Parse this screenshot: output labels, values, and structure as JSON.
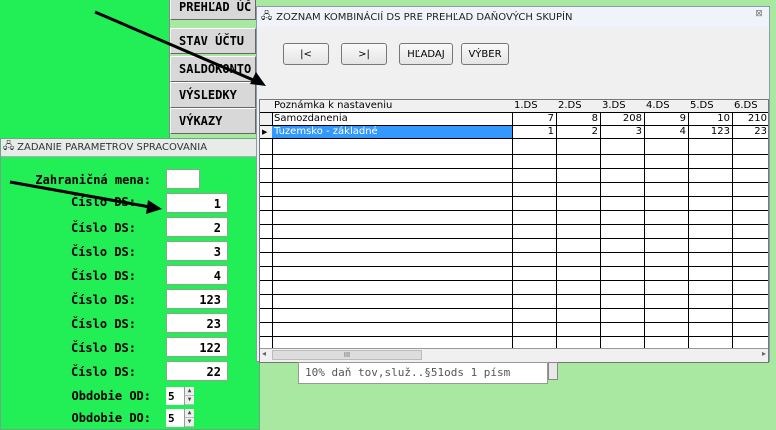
{
  "menu": [
    {
      "label": "PREHĽAD ÚČ"
    },
    {
      "label": "STAV ÚČTU"
    },
    {
      "label": "SALDOKONTO"
    },
    {
      "label": "VÝSLEDKY"
    },
    {
      "label": "VÝKAZY"
    }
  ],
  "param_window": {
    "title": "ZADANIE PARAMETROV SPRACOVANIA",
    "rows": [
      {
        "label": "Zahraničná mena:",
        "value": ""
      },
      {
        "label": "Číslo DS:",
        "value": "1"
      },
      {
        "label": "Číslo DS:",
        "value": "2"
      },
      {
        "label": "Číslo DS:",
        "value": "3"
      },
      {
        "label": "Číslo DS:",
        "value": "4"
      },
      {
        "label": "Číslo DS:",
        "value": "123"
      },
      {
        "label": "Číslo DS:",
        "value": "23"
      },
      {
        "label": "Číslo DS:",
        "value": "122"
      },
      {
        "label": "Číslo DS:",
        "value": "22"
      },
      {
        "label": "Obdobie OD:",
        "value": "5"
      },
      {
        "label": "Obdobie DO:",
        "value": "5"
      }
    ]
  },
  "dialog": {
    "title": "ZOZNAM KOMBINÁCIÍ DS PRE PREHĽAD DAŇOVÝCH SKUPÍN",
    "close": "⊠",
    "buttons": {
      "first": "|<",
      "last": ">|",
      "search": "HĽADAJ",
      "select": "VÝBER"
    },
    "columns": [
      "Poznámka k nastaveniu",
      "1.DS",
      "2.DS",
      "3.DS",
      "4.DS",
      "5.DS",
      "6.DS"
    ],
    "rows": [
      [
        "Samozdanenia",
        "7",
        "8",
        "208",
        "9",
        "10",
        "210"
      ],
      [
        "Tuzemsko - základné",
        "1",
        "2",
        "3",
        "4",
        "123",
        "23"
      ]
    ],
    "scroll_label": "III"
  },
  "tooltip": "10% daň tov,služ..§51ods 1 písm"
}
